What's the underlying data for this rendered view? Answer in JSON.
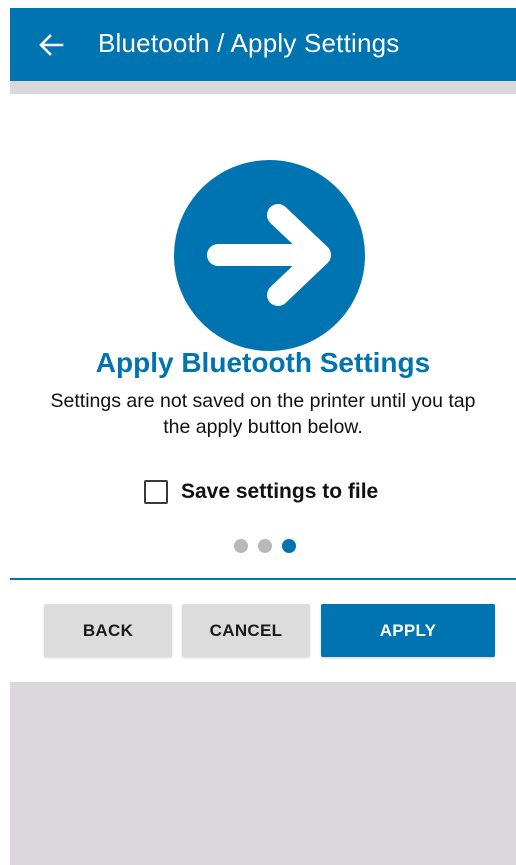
{
  "appbar": {
    "title": "Bluetooth / Apply Settings",
    "back_icon": "arrow-left-icon",
    "color": "#0074b0"
  },
  "card": {
    "hero_icon": "arrow-right-circle-icon",
    "title": "Apply Bluetooth Settings",
    "description": "Settings are not saved on the printer until you tap the apply button below.",
    "save_checkbox": {
      "label": "Save settings to file",
      "checked": false
    },
    "pager": {
      "total": 3,
      "active_index": 2
    }
  },
  "buttons": {
    "back": "BACK",
    "cancel": "CANCEL",
    "apply": "APPLY"
  },
  "colors": {
    "accent": "#0074b0",
    "background": "#dad8da",
    "button_grey": "#dcdcdc"
  }
}
